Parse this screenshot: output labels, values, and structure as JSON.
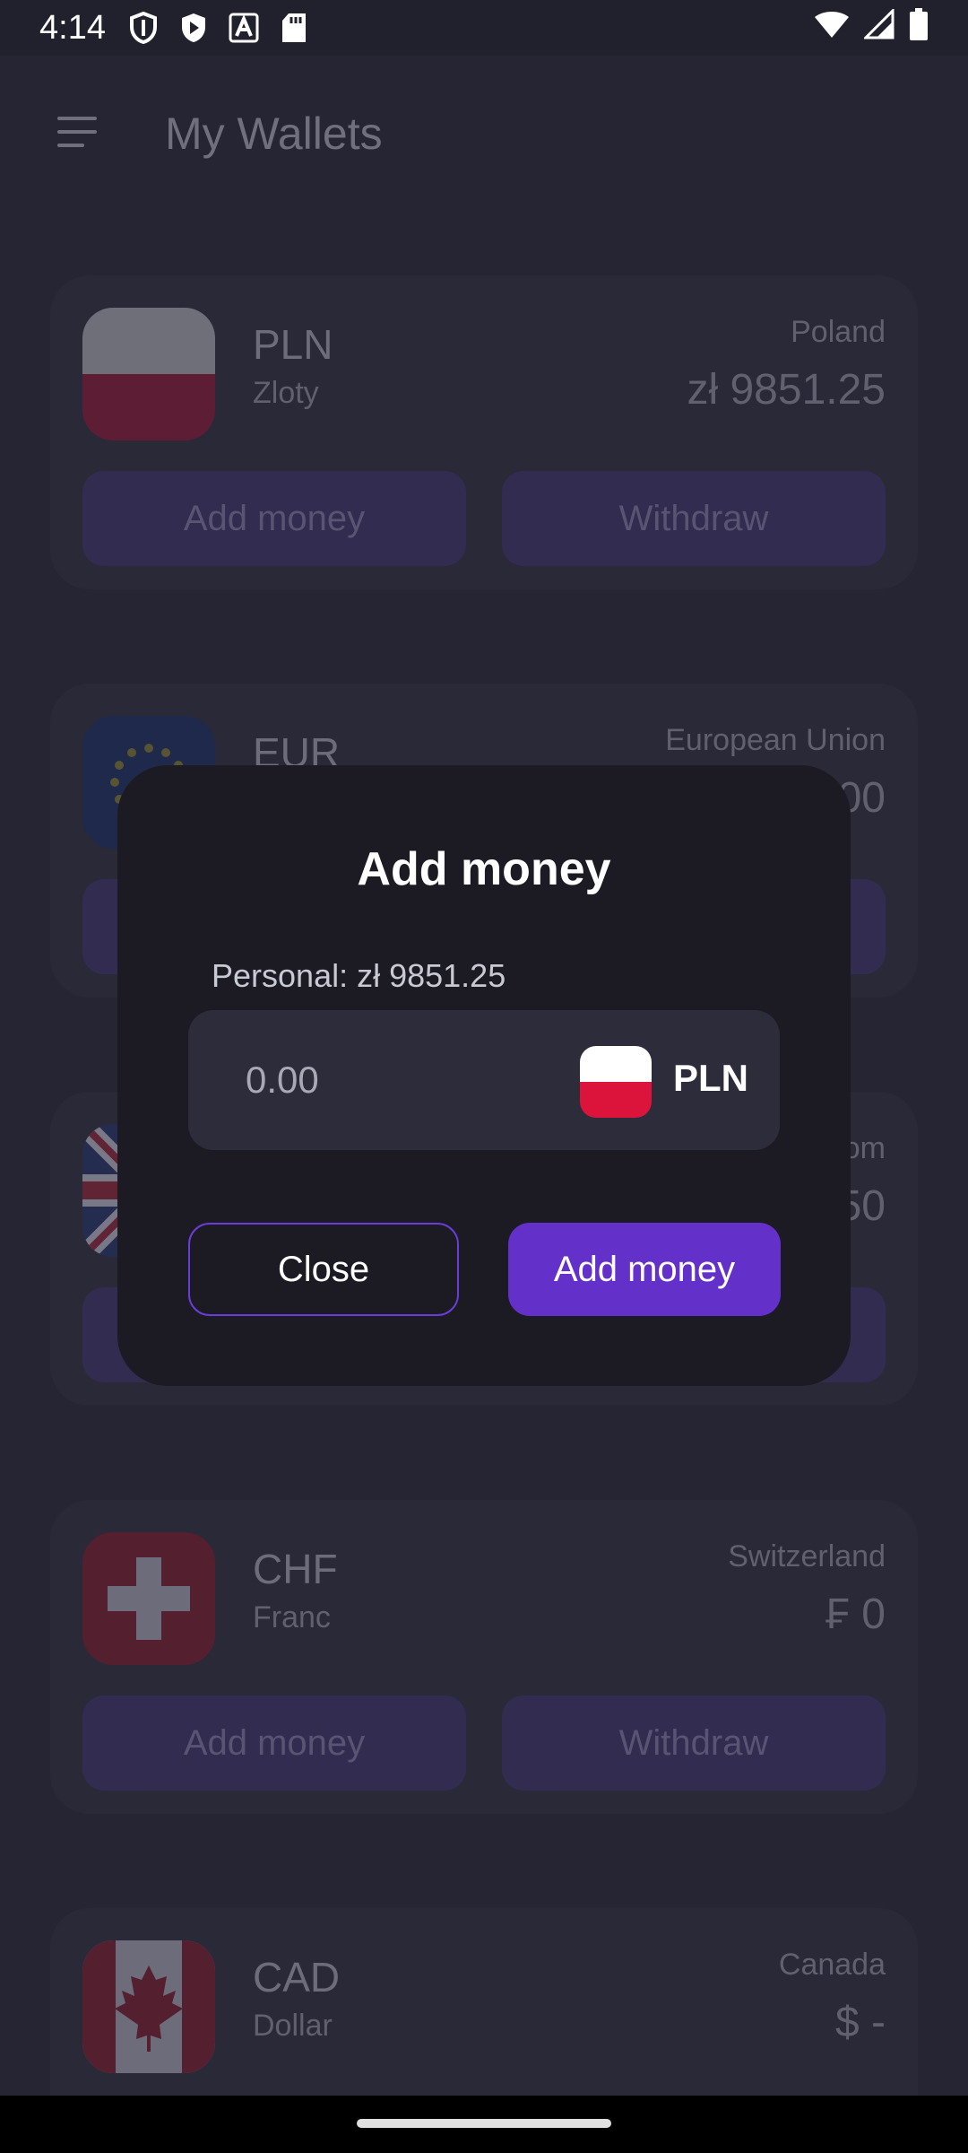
{
  "status_bar": {
    "time": "4:14",
    "left_icons": [
      "shield-icon",
      "play-protect-icon",
      "a-icon",
      "sd-card-icon"
    ],
    "right_icons": [
      "wifi-icon",
      "signal-icon",
      "battery-icon"
    ]
  },
  "app_bar": {
    "title": "My Wallets",
    "menu_icon": "menu-icon"
  },
  "wallets": [
    {
      "code": "PLN",
      "name": "Zloty",
      "country": "Poland",
      "balance": "zł 9851.25",
      "add_label": "Add money",
      "withdraw_label": "Withdraw",
      "flag": "poland-flag"
    },
    {
      "code": "EUR",
      "name": "",
      "country": "European Union",
      "balance": "00",
      "add_label": "",
      "withdraw_label": "",
      "flag": "eu-flag"
    },
    {
      "code": "",
      "name": "",
      "country": "om",
      "balance": "50",
      "add_label": "",
      "withdraw_label": "",
      "flag": "uk-flag"
    },
    {
      "code": "CHF",
      "name": "Franc",
      "country": "Switzerland",
      "balance": "₣ 0",
      "add_label": "Add money",
      "withdraw_label": "Withdraw",
      "flag": "swiss-flag"
    },
    {
      "code": "CAD",
      "name": "Dollar",
      "country": "Canada",
      "balance": "$ -",
      "add_label": "",
      "withdraw_label": "",
      "flag": "canada-flag"
    }
  ],
  "dialog": {
    "title": "Add money",
    "balance_label": "Personal: zł 9851.25",
    "amount_placeholder": "0.00",
    "currency_code": "PLN",
    "close_label": "Close",
    "add_label": "Add money"
  },
  "colors": {
    "background": "#2b2b3b",
    "dialog": "#1c1b23",
    "accent": "#6331c9",
    "input_bg": "#2d2c3b"
  }
}
